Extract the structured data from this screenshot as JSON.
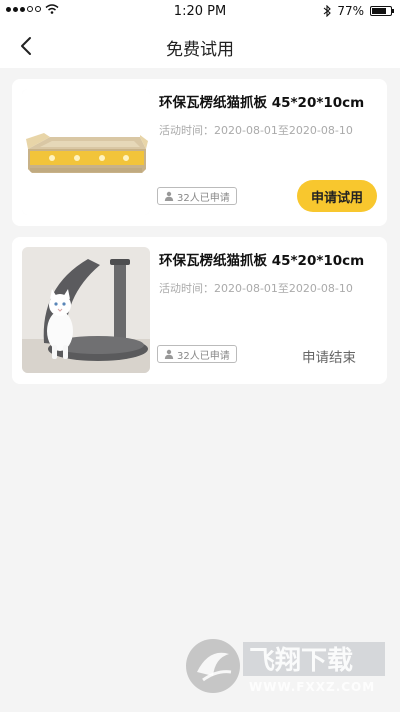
{
  "status_bar": {
    "time": "1:20 PM",
    "battery_text": "77%",
    "battery_level": 0.77
  },
  "nav": {
    "title": "免费试用"
  },
  "products": [
    {
      "title": "环保瓦楞纸猫抓板 45*20*10cm",
      "period": "活动时间：2020-08-01至2020-08-10",
      "applicants": "32人已申请",
      "action_label": "申请试用",
      "action_state": "active"
    },
    {
      "title": "环保瓦楞纸猫抓板 45*20*10cm",
      "period": "活动时间：2020-08-01至2020-08-10",
      "applicants": "32人已申请",
      "action_label": "申请结束",
      "action_state": "ended"
    }
  ],
  "watermark": {
    "brand": "飞翔下载",
    "url": "WWW.FXXZ.COM"
  },
  "colors": {
    "accent": "#f8c72e",
    "page_bg": "#f4f4f4"
  }
}
